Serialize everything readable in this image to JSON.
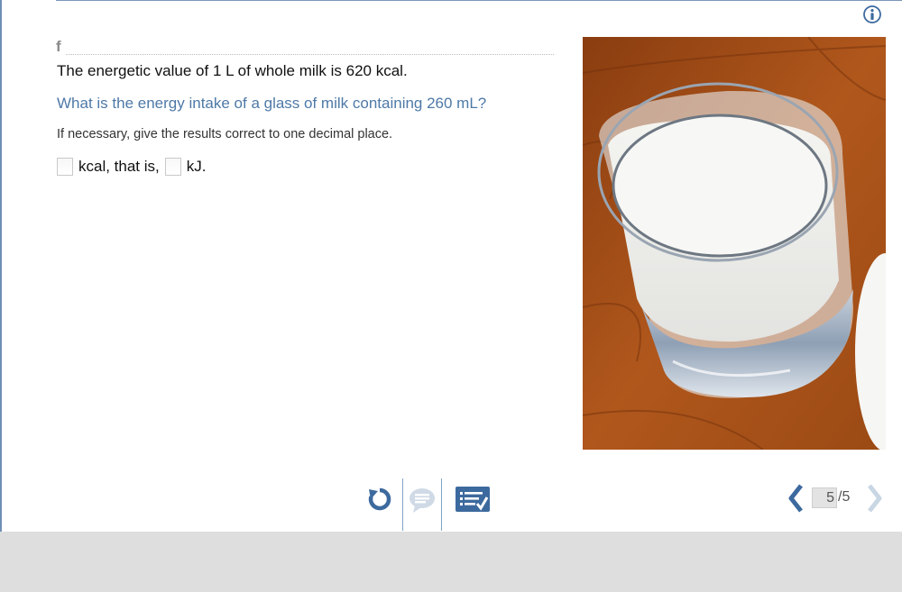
{
  "exercise": {
    "section_letter": "f",
    "statement": "The energetic value of 1 L of whole milk is 620 kcal.",
    "question": "What is the energy intake of a glass of milk containing 260 mL?",
    "instruction": "If necessary, give the results correct to one decimal place.",
    "answer": {
      "unit1_label": "kcal, that is,",
      "unit2_label": "kJ.",
      "value1": "",
      "value2": ""
    }
  },
  "image": {
    "subject": "glass-of-milk-photo"
  },
  "toolbar": {
    "icons": [
      "retry-icon",
      "comment-icon",
      "checklist-icon"
    ]
  },
  "pager": {
    "current": "5",
    "total_label": "/5"
  },
  "colors": {
    "question_blue": "#4e79a7",
    "accent_blue": "#3d6a9e",
    "footer_gray": "#dedede"
  }
}
